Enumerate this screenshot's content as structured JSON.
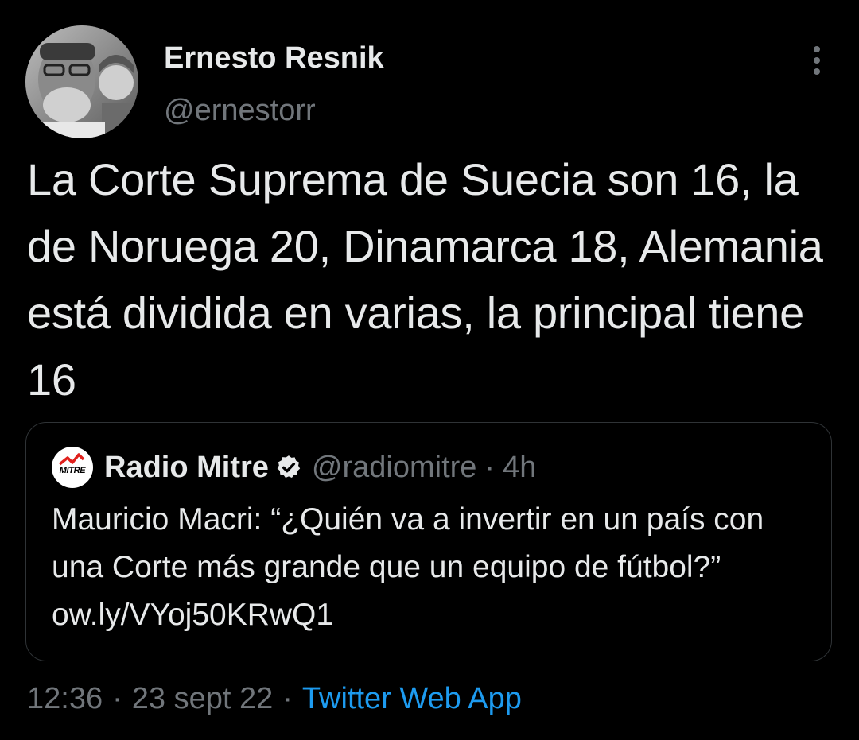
{
  "tweet": {
    "author_name": "Ernesto Resnik",
    "author_handle": "@ernestorr",
    "text": "La Corte Suprema de Suecia son 16, la de Noruega 20, Dinamarca 18, Alemania está dividida en varias, la principal tiene 16",
    "time": "12:36",
    "separator": "·",
    "date": "23 sept 22",
    "source": "Twitter Web App"
  },
  "quote": {
    "avatar_text": "MITRE",
    "author_name": "Radio Mitre",
    "author_handle": "@radiomitre",
    "separator": "·",
    "time": "4h",
    "text": "Mauricio Macri: “¿Quién va a invertir en un país con una Corte más grande que un equipo de fútbol?” ow.ly/VYoj50KRwQ1"
  },
  "icons": {
    "more": "more-vertical-icon",
    "verified": "verified-badge-icon"
  },
  "colors": {
    "background": "#000000",
    "primary_text": "#e7e9ea",
    "secondary_text": "#71767b",
    "link": "#1d9bf0",
    "border": "#2f3336"
  }
}
